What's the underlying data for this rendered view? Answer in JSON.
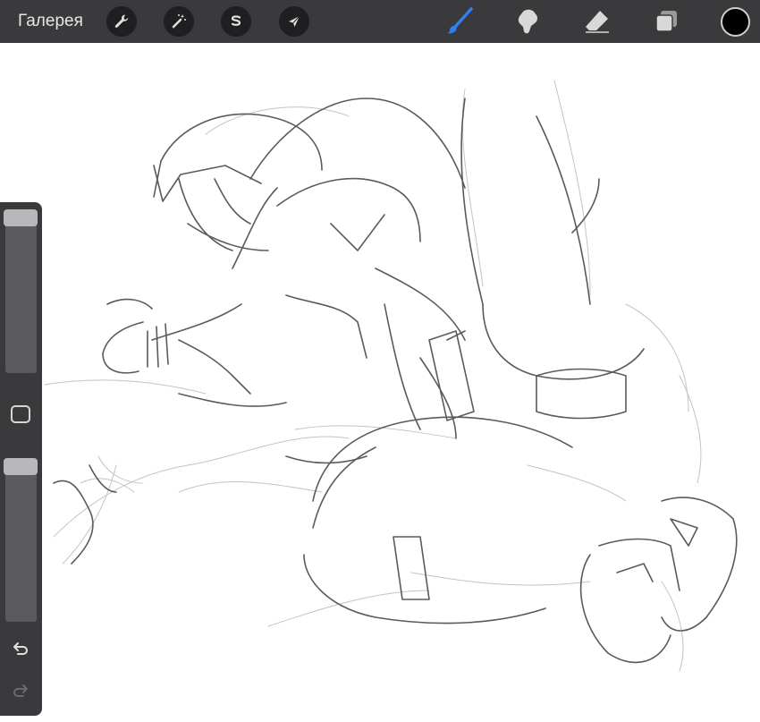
{
  "toolbar": {
    "gallery_label": "Галерея",
    "left_tools": [
      {
        "name": "actions",
        "icon": "wrench-icon"
      },
      {
        "name": "adjustments",
        "icon": "magic-wand-icon"
      },
      {
        "name": "selection",
        "icon": "selection-s-icon"
      },
      {
        "name": "transform",
        "icon": "arrow-cursor-icon"
      }
    ],
    "right_tools": [
      {
        "name": "brush",
        "icon": "brush-icon",
        "active": true
      },
      {
        "name": "smudge",
        "icon": "smudge-icon",
        "active": false
      },
      {
        "name": "eraser",
        "icon": "eraser-icon",
        "active": false
      },
      {
        "name": "layers",
        "icon": "layers-icon",
        "active": false
      }
    ],
    "current_color": "#000000"
  },
  "sidebar": {
    "brush_size_level": 1.0,
    "brush_opacity_level": 1.0,
    "modify_icon": "square-icon",
    "undo_icon": "undo-icon",
    "redo_icon": "redo-icon",
    "redo_enabled": false
  },
  "colors": {
    "toolbar_bg": "#3a3a3c",
    "active_tool": "#2f7ff5",
    "icon": "#d8d8d8",
    "sketch_line": "#555555"
  }
}
